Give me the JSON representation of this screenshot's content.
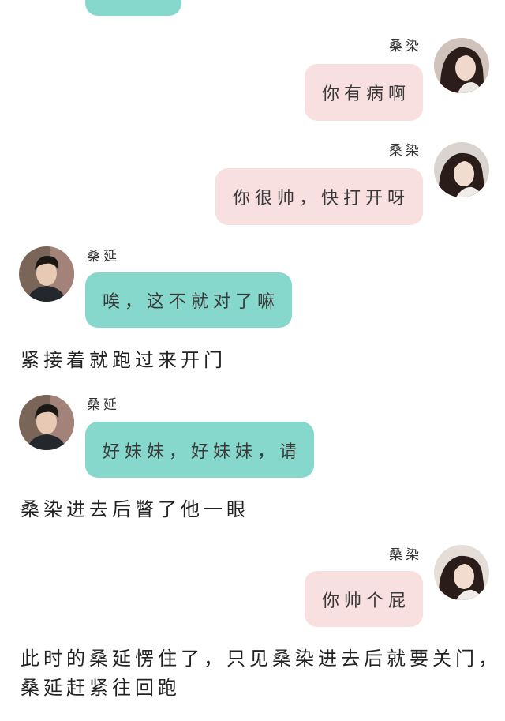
{
  "colors": {
    "left_bubble": "#86d8cc",
    "right_bubble": "#f8dfe0",
    "background": "#ffffff"
  },
  "speakers": {
    "female": "桑染",
    "male": "桑延"
  },
  "messages": [
    {
      "side": "right",
      "speaker": "桑染",
      "text": "你有病啊"
    },
    {
      "side": "right",
      "speaker": "桑染",
      "text": "你很帅，快打开呀"
    },
    {
      "side": "left",
      "speaker": "桑延",
      "text": "唉，这不就对了嘛"
    },
    {
      "side": "left",
      "speaker": "桑延",
      "text": "好妹妹，好妹妹，请"
    },
    {
      "side": "right",
      "speaker": "桑染",
      "text": "你帅个屁"
    }
  ],
  "narration": [
    "紧接着就跑过来开门",
    "桑染进去后瞥了他一眼",
    "此时的桑延愣住了，只见桑染进去后就要关门，",
    "桑延赶紧往回跑"
  ]
}
